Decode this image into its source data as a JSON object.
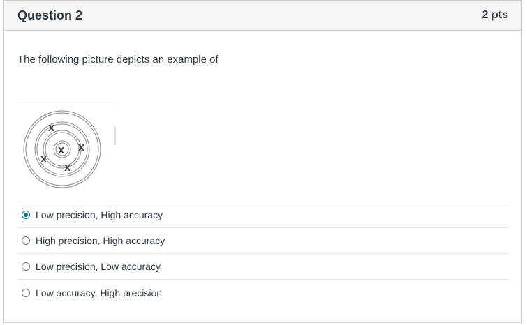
{
  "question": {
    "title": "Question 2",
    "points": "2 pts",
    "prompt": "The following picture depicts an example of",
    "figure_marks": [
      "X",
      "X",
      "X",
      "X",
      "X"
    ]
  },
  "answers": [
    {
      "label": "Low precision, High accuracy",
      "selected": true
    },
    {
      "label": "High precision, High accuracy",
      "selected": false
    },
    {
      "label": "Low precision, Low accuracy",
      "selected": false
    },
    {
      "label": "Low accuracy, High precision",
      "selected": false
    }
  ],
  "colors": {
    "selected_radio": "#0770a3",
    "header_bg": "#f5f5f5",
    "border": "#c7cdd1"
  }
}
